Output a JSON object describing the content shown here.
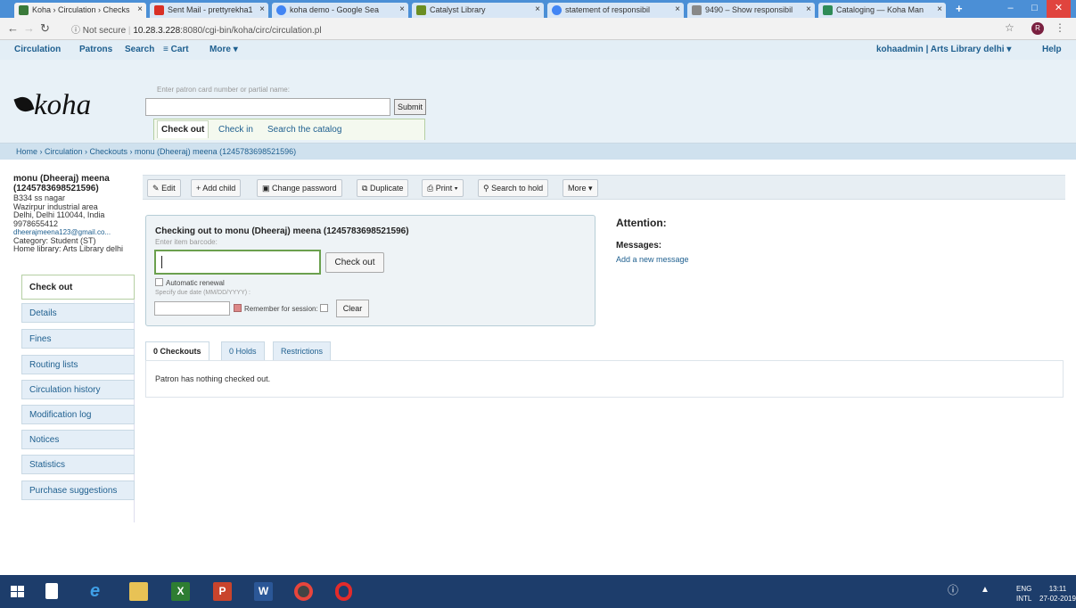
{
  "browser": {
    "tabs": [
      {
        "title": "Koha › Circulation › Checks",
        "color": "#3a7a3a",
        "active": true
      },
      {
        "title": "Sent Mail - prettyrekha1",
        "color": "#d93025",
        "active": false
      },
      {
        "title": "koha demo - Google Sea",
        "color": "#4285f4",
        "active": false
      },
      {
        "title": "Catalyst Library",
        "color": "#6b8e23",
        "active": false
      },
      {
        "title": "statement of responsibil",
        "color": "#4285f4",
        "active": false
      },
      {
        "title": "9490 – Show responsibil",
        "color": "#888888",
        "active": false
      },
      {
        "title": "Cataloging — Koha Man",
        "color": "#2e8b57",
        "active": false
      }
    ],
    "tab_close": "×",
    "new_tab": "+",
    "not_secure": "Not secure",
    "url_host": "10.28.3.228",
    "url_path": ":8080/cgi-bin/koha/circ/circulation.pl",
    "profile_initial": "R"
  },
  "koha": {
    "topnav": [
      "Circulation",
      "Patrons",
      "Search",
      "Cart",
      "More"
    ],
    "user": "kohaadmin | Arts Library delhi",
    "help": "Help",
    "logo": "koha",
    "patron_search_label": "Enter patron card number or partial name:",
    "submit": "Submit",
    "circ_tabs": [
      "Check out",
      "Check in",
      "Search the catalog"
    ],
    "breadcrumb": "Home › Circulation › Checkouts › monu (Dheeraj) meena (1245783698521596)"
  },
  "patron": {
    "name": "monu (Dheeraj) meena",
    "cardnumber": "(1245783698521596)",
    "address1": "B334 ss nagar",
    "address2": "Wazirpur industrial area",
    "city": "Delhi, Delhi 110044, India",
    "phone": "9978655412",
    "email": "dheerajmeena123@gmail.co...",
    "category": "Category: Student (ST)",
    "library": "Home library: Arts Library delhi"
  },
  "leftnav": [
    "Check out",
    "Details",
    "Fines",
    "Routing lists",
    "Circulation history",
    "Modification log",
    "Notices",
    "Statistics",
    "Purchase suggestions"
  ],
  "toolbar": [
    "Edit",
    "Add child",
    "Change password",
    "Duplicate",
    "Print",
    "Search to hold",
    "More"
  ],
  "checkout": {
    "title": "Checking out to monu (Dheeraj) meena (1245783698521596)",
    "barcode_label": "Enter item barcode:",
    "button": "Check out",
    "auto_renew": "Automatic renewal",
    "due_label": "Specify due date (MM/DD/YYYY) :",
    "remember": "Remember for session:",
    "clear": "Clear"
  },
  "attention": "Attention:",
  "messages": "Messages:",
  "add_message": "Add a new message",
  "bottom_tabs": [
    "0 Checkouts",
    "0 Holds",
    "Restrictions"
  ],
  "panel_text": "Patron has nothing checked out.",
  "tray": {
    "lang1": "ENG",
    "lang2": "INTL",
    "time": "13:11",
    "date": "27-02-2019"
  }
}
